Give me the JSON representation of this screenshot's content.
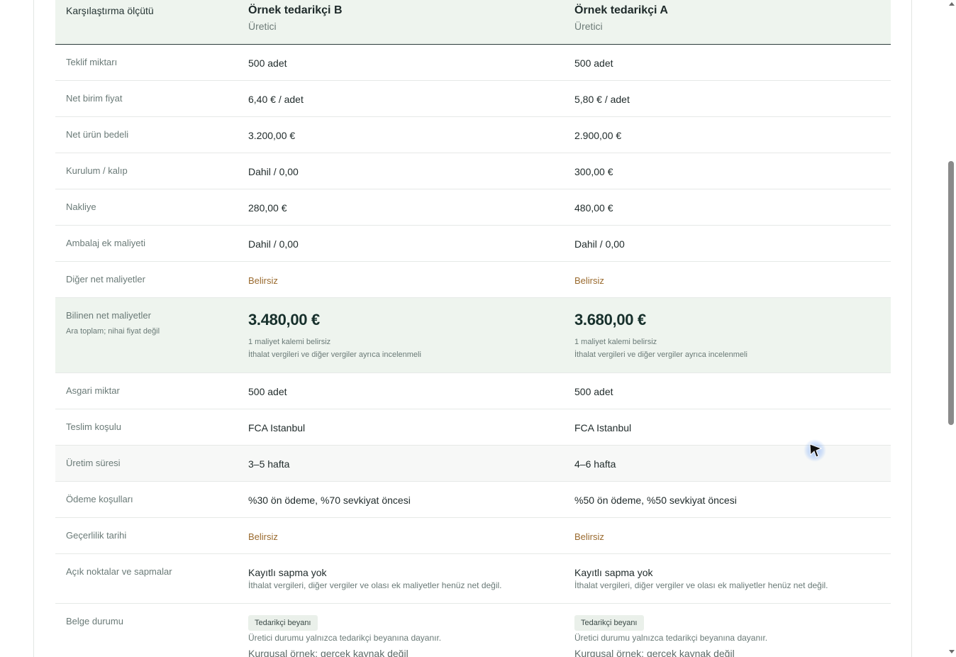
{
  "table": {
    "header": {
      "criterion_label": "Karşılaştırma ölçütü",
      "suppliers": [
        {
          "name": "Örnek tedarikçi B",
          "type": "Üretici"
        },
        {
          "name": "Örnek tedarikçi A",
          "type": "Üretici"
        }
      ]
    },
    "cost_rows": [
      {
        "label": "Teklif miktarı",
        "values": [
          "500 adet",
          "500 adet"
        ]
      },
      {
        "label": "Net birim fiyat",
        "values": [
          "6,40 € / adet",
          "5,80 € / adet"
        ]
      },
      {
        "label": "Net ürün bedeli",
        "values": [
          "3.200,00 €",
          "2.900,00 €"
        ]
      },
      {
        "label": "Kurulum / kalıp",
        "values": [
          "Dahil / 0,00",
          "300,00 €"
        ]
      },
      {
        "label": "Nakliye",
        "values": [
          "280,00 €",
          "480,00 €"
        ]
      },
      {
        "label": "Ambalaj ek maliyeti",
        "values": [
          "Dahil / 0,00",
          "Dahil / 0,00"
        ]
      },
      {
        "label": "Diğer net maliyetler",
        "values": [
          "Belirsiz",
          "Belirsiz"
        ]
      }
    ],
    "total": {
      "label": "Bilinen net maliyetler",
      "sublabel": "Ara toplam; nihai fiyat değil",
      "values": [
        "3.480,00 €",
        "3.680,00 €"
      ],
      "notes_1": [
        "1 maliyet kalemi belirsiz",
        "1 maliyet kalemi belirsiz"
      ],
      "notes_2": [
        "İthalat vergileri ve diğer vergiler ayrıca incelenmeli",
        "İthalat vergileri ve diğer vergiler ayrıca incelenmeli"
      ]
    },
    "term_rows": [
      {
        "label": "Asgari miktar",
        "values": [
          "500 adet",
          "500 adet"
        ]
      },
      {
        "label": "Teslim koşulu",
        "values": [
          "FCA Istanbul",
          "FCA Istanbul"
        ]
      },
      {
        "label": "Üretim süresi",
        "values": [
          "3–5 hafta",
          "4–6 hafta"
        ]
      },
      {
        "label": "Ödeme koşulları",
        "values": [
          "%30 ön ödeme, %70 sevkiyat öncesi",
          "%50 ön ödeme, %50 sevkiyat öncesi"
        ]
      },
      {
        "label": "Geçerlilik tarihi",
        "values": [
          "Belirsiz",
          "Belirsiz"
        ]
      }
    ],
    "open_points": {
      "label": "Açık noktalar ve sapmalar",
      "values": [
        "Kayıtlı sapma yok",
        "Kayıtlı sapma yok"
      ],
      "subs": [
        "İthalat vergileri, diğer vergiler ve olası ek maliyetler henüz net değil.",
        "İthalat vergileri, diğer vergiler ve olası ek maliyetler henüz net değil."
      ]
    },
    "document": {
      "label": "Belge durumu",
      "badges": [
        "Tedarikçi beyanı",
        "Tedarikçi beyanı"
      ],
      "notes": [
        "Üretici durumu yalnızca tedarikçi beyanına dayanır.",
        "Üretici durumu yalnızca tedarikçi beyanına dayanır."
      ],
      "fictional": [
        "Kurgusal örnek; gerçek kaynak değil",
        "Kurgusal örnek; gerçek kaynak değil"
      ]
    }
  },
  "colors": {
    "header_bg": "#eef4ee",
    "unknown_text": "#9a6a2e",
    "cursor_highlight": "#3b82f6"
  },
  "cursor": {
    "icon": "mouse-pointer-icon"
  }
}
